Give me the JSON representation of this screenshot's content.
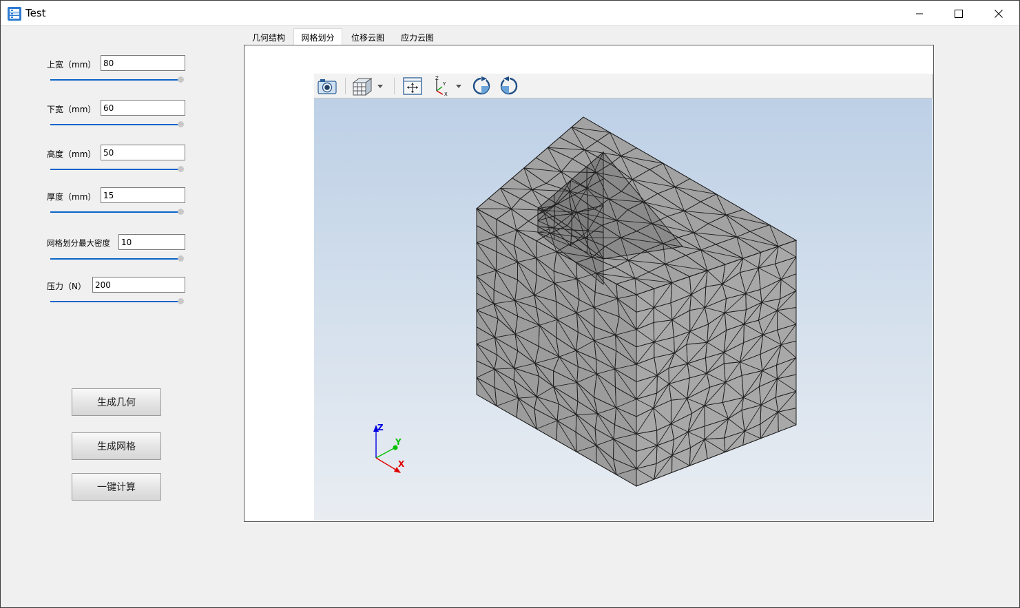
{
  "window": {
    "title": "Test",
    "controls": [
      "minimize",
      "maximize",
      "close"
    ]
  },
  "params": [
    {
      "label": "上宽（mm）",
      "value": "80"
    },
    {
      "label": "下宽（mm）",
      "value": "60"
    },
    {
      "label": "高度（mm）",
      "value": "50"
    },
    {
      "label": "厚度（mm）",
      "value": "15"
    },
    {
      "label": "网格划分最大密度",
      "value": "10"
    },
    {
      "label": "压力（N）",
      "value": "200"
    }
  ],
  "buttons": {
    "generate_geometry": "生成几何",
    "generate_mesh": "生成网格",
    "compute": "一键计算"
  },
  "tabs": [
    {
      "label": "几何结构",
      "active": false
    },
    {
      "label": "网格划分",
      "active": true
    },
    {
      "label": "位移云图",
      "active": false
    },
    {
      "label": "应力云图",
      "active": false
    }
  ],
  "viewer": {
    "toolbar_icons": [
      "camera-icon",
      "view-cube-icon",
      "fit-all-icon",
      "axis-orientation-icon",
      "rotate-cw-icon",
      "rotate-ccw-icon"
    ],
    "axis_labels": {
      "z": "Z",
      "y": "Y",
      "x": "X"
    },
    "mesh_color": "#a6a6a6"
  },
  "colors": {
    "slider": "#0a64c8",
    "axis_x": "#e00000",
    "axis_y": "#00c000",
    "axis_z": "#0000e0"
  }
}
